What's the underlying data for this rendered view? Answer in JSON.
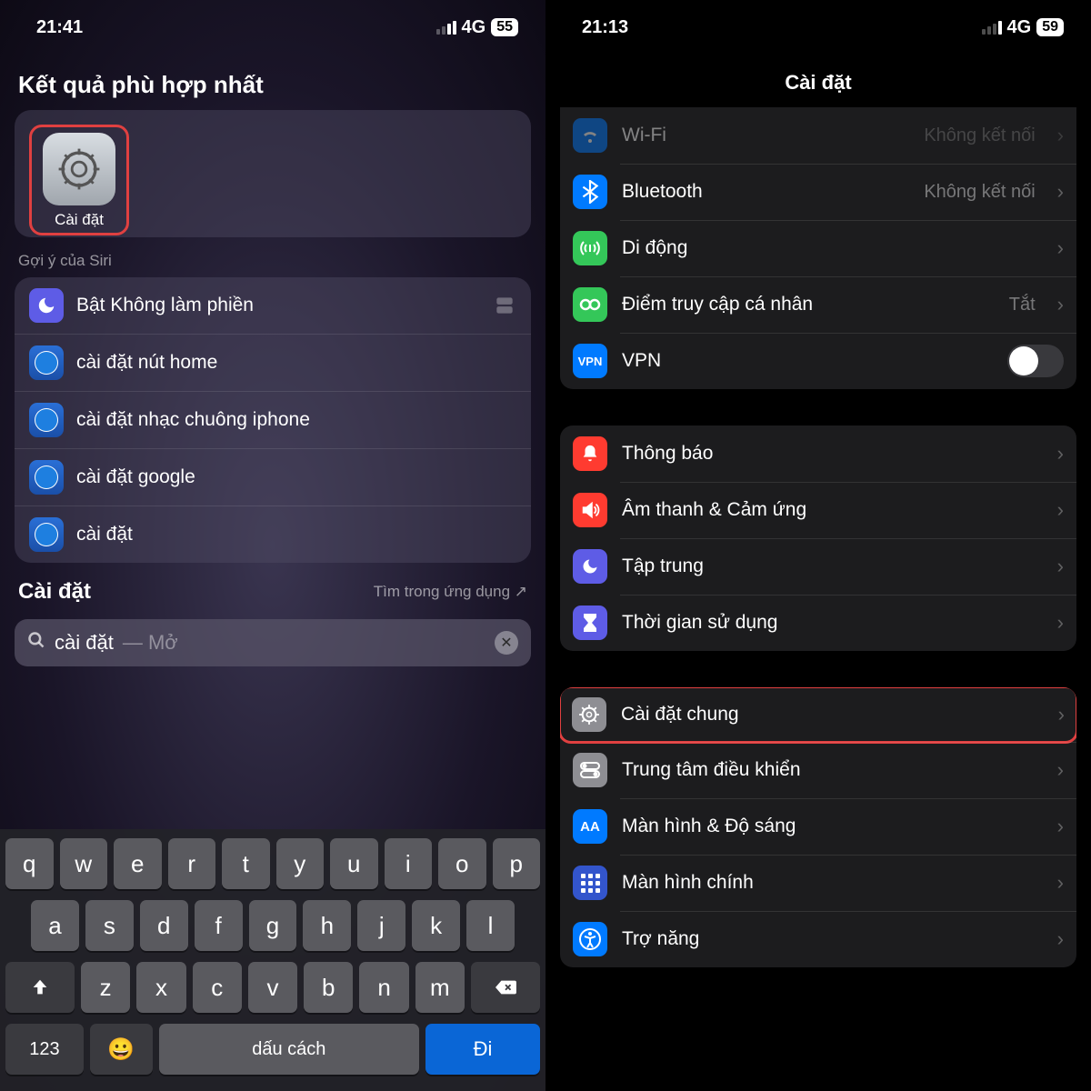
{
  "left": {
    "status": {
      "time": "21:41",
      "network": "4G",
      "battery": "55"
    },
    "top_hit_title": "Kết quả phù hợp nhất",
    "app_result": {
      "label": "Cài đặt"
    },
    "siri_label": "Gợi ý của Siri",
    "suggestions": [
      {
        "label": "Bật Không làm phiền",
        "icon": "moon"
      },
      {
        "label": "cài đặt nút home",
        "icon": "safari"
      },
      {
        "label": "cài đặt nhạc chuông iphone",
        "icon": "safari"
      },
      {
        "label": "cài đặt google",
        "icon": "safari"
      },
      {
        "label": "cài đặt",
        "icon": "safari"
      }
    ],
    "sub_header": {
      "title": "Cài đặt",
      "link": "Tìm trong ứng dụng ↗"
    },
    "search": {
      "query": "cài đặt",
      "hint": "— Mở"
    },
    "keyboard": {
      "row1": [
        "q",
        "w",
        "e",
        "r",
        "t",
        "y",
        "u",
        "i",
        "o",
        "p"
      ],
      "row2": [
        "a",
        "s",
        "d",
        "f",
        "g",
        "h",
        "j",
        "k",
        "l"
      ],
      "row3": [
        "z",
        "x",
        "c",
        "v",
        "b",
        "n",
        "m"
      ],
      "numkey": "123",
      "space": "dấu cách",
      "go": "Đi"
    }
  },
  "right": {
    "status": {
      "time": "21:13",
      "network": "4G",
      "battery": "59"
    },
    "title": "Cài đặt",
    "group1": [
      {
        "icon": "wifi",
        "label": "Wi-Fi",
        "detail": "Không kết nối",
        "chevron": true
      },
      {
        "icon": "bt",
        "label": "Bluetooth",
        "detail": "Không kết nối",
        "chevron": true
      },
      {
        "icon": "cell",
        "label": "Di động",
        "detail": "",
        "chevron": true
      },
      {
        "icon": "hotspot",
        "label": "Điểm truy cập cá nhân",
        "detail": "Tắt",
        "chevron": true
      },
      {
        "icon": "vpn",
        "label": "VPN",
        "toggle": true
      }
    ],
    "group2": [
      {
        "icon": "notif",
        "label": "Thông báo"
      },
      {
        "icon": "sound",
        "label": "Âm thanh & Cảm ứng"
      },
      {
        "icon": "focus",
        "label": "Tập trung"
      },
      {
        "icon": "screentime",
        "label": "Thời gian sử dụng"
      }
    ],
    "group3": [
      {
        "icon": "general",
        "label": "Cài đặt chung",
        "highlight": true
      },
      {
        "icon": "control",
        "label": "Trung tâm điều khiển"
      },
      {
        "icon": "display",
        "label": "Màn hình & Độ sáng"
      },
      {
        "icon": "home",
        "label": "Màn hình chính"
      },
      {
        "icon": "access",
        "label": "Trợ năng"
      }
    ]
  }
}
